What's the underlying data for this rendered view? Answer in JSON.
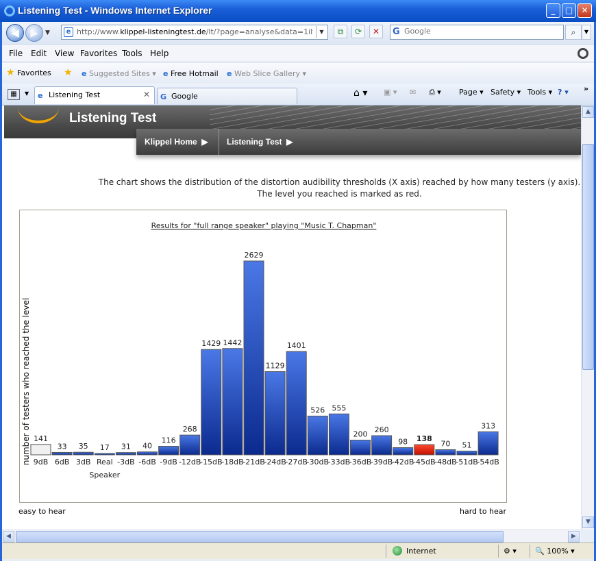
{
  "window": {
    "title": "Listening Test - Windows Internet Explorer",
    "minimize": "_",
    "maximize": "□",
    "close": "✕"
  },
  "address_bar": {
    "url_prefix": "http://www.",
    "url_domain": "klippel-listeningtest.de",
    "url_suffix": "/lt/?page=analyse&data=1ilt%260%2",
    "search_placeholder": "Google"
  },
  "menu": [
    "File",
    "Edit",
    "View",
    "Favorites",
    "Tools",
    "Help"
  ],
  "favorites_bar": {
    "favorites_label": "Favorites",
    "items": [
      "Suggested Sites",
      "Free Hotmail",
      "Web Slice Gallery"
    ]
  },
  "tabs": [
    {
      "label": "Listening Test",
      "active": true
    },
    {
      "label": "Google",
      "active": false
    }
  ],
  "command_bar": [
    "Page",
    "Safety",
    "Tools"
  ],
  "site": {
    "banner_title": "Listening Test",
    "nav": [
      "Klippel Home",
      "Listening Test"
    ]
  },
  "description": {
    "line1": "The chart shows the distribution of the distortion audibility thresholds (X axis) reached by how many testers (y axis).",
    "line2": "The level you reached is marked as red."
  },
  "chart_data": {
    "type": "bar",
    "title": "Results for \"full range speaker\" playing \"Music T. Chapman\"",
    "ylabel": "number of testers who reached the level",
    "xlabel": "",
    "categories": [
      "9dB",
      "6dB",
      "3dB",
      "Real Speaker",
      "-3dB",
      "-6dB",
      "-9dB",
      "-12dB",
      "-15dB",
      "-18dB",
      "-21dB",
      "-24dB",
      "-27dB",
      "-30dB",
      "-33dB",
      "-36dB",
      "-39dB",
      "-42dB",
      "-45dB",
      "-48dB",
      "-51dB",
      "-54dB"
    ],
    "values": [
      141,
      33,
      35,
      17,
      31,
      40,
      116,
      268,
      1429,
      1442,
      2629,
      1129,
      1401,
      526,
      555,
      200,
      260,
      98,
      138,
      70,
      51,
      313
    ],
    "highlight_index": 18,
    "colors": {
      "bar": "#2a4fc6",
      "bar_dark": "#0b2a8e",
      "highlight": "#e02010",
      "first": "#f0f0f0"
    },
    "ylim": [
      0,
      2629
    ]
  },
  "chart_footer": {
    "left": "easy to hear",
    "right": "hard to hear"
  },
  "status_bar": {
    "zone": "Internet",
    "zoom": "100%"
  }
}
